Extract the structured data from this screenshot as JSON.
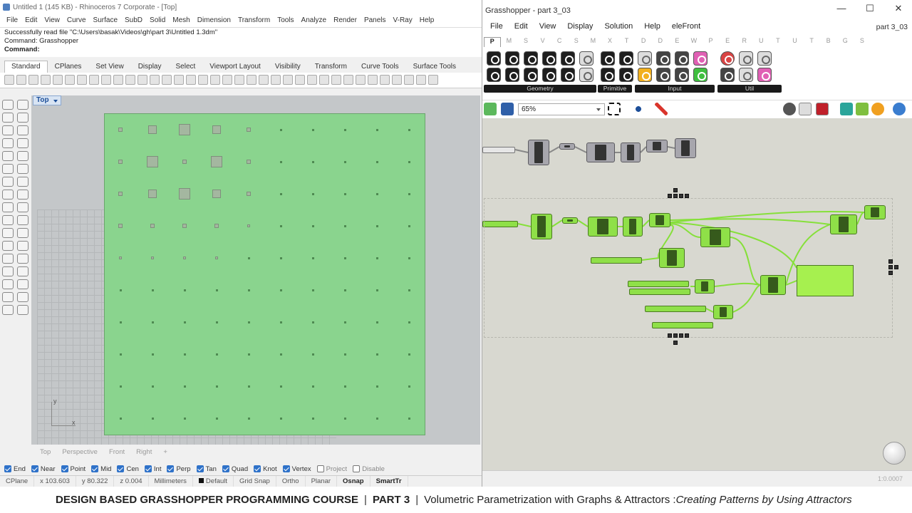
{
  "rhino": {
    "title": "Untitled 1 (145 KB) - Rhinoceros 7 Corporate - [Top]",
    "menu": [
      "File",
      "Edit",
      "View",
      "Curve",
      "Surface",
      "SubD",
      "Solid",
      "Mesh",
      "Dimension",
      "Transform",
      "Tools",
      "Analyze",
      "Render",
      "Panels",
      "V-Ray",
      "Help"
    ],
    "command_history": [
      "Successfully read file \"C:\\Users\\basak\\Videos\\gh\\part 3\\Untitled 1.3dm\"",
      "Command: Grasshopper"
    ],
    "command_prompt": "Command:",
    "toolbar_tabs": [
      "Standard",
      "CPlanes",
      "Set View",
      "Display",
      "Select",
      "Viewport Layout",
      "Visibility",
      "Transform",
      "Curve Tools",
      "Surface Tools"
    ],
    "active_tab": "Standard",
    "viewport_label": "Top",
    "axis_labels": {
      "x": "x",
      "y": "y"
    },
    "viewport_tabs": [
      "Top",
      "Perspective",
      "Front",
      "Right"
    ],
    "osnaps": [
      {
        "label": "End",
        "checked": true
      },
      {
        "label": "Near",
        "checked": true
      },
      {
        "label": "Point",
        "checked": true
      },
      {
        "label": "Mid",
        "checked": true
      },
      {
        "label": "Cen",
        "checked": true
      },
      {
        "label": "Int",
        "checked": true
      },
      {
        "label": "Perp",
        "checked": true
      },
      {
        "label": "Tan",
        "checked": true
      },
      {
        "label": "Quad",
        "checked": true
      },
      {
        "label": "Knot",
        "checked": true
      },
      {
        "label": "Vertex",
        "checked": true
      },
      {
        "label": "Project",
        "checked": false
      },
      {
        "label": "Disable",
        "checked": false
      }
    ],
    "status": {
      "cplane": "CPlane",
      "x": "x 103.603",
      "y": "y 80.322",
      "z": "z 0.004",
      "units": "Millimeters",
      "layer": "Default",
      "grid_snap": "Grid Snap",
      "ortho": "Ortho",
      "planar": "Planar",
      "osnap": "Osnap",
      "smarttrack": "SmartTr"
    },
    "colors": {
      "plane": "#8ad48e",
      "viewport_bg": "#c4c7c9"
    }
  },
  "grasshopper": {
    "title": "Grasshopper - part 3_03",
    "menu": [
      "File",
      "Edit",
      "View",
      "Display",
      "Solution",
      "Help",
      "eleFront"
    ],
    "doc_name": "part 3_03",
    "category_tabs": [
      "P",
      "M",
      "S",
      "V",
      "C",
      "S",
      "M",
      "X",
      "T",
      "D",
      "D",
      "E",
      "W",
      "P",
      "E",
      "R",
      "U",
      "T",
      "U",
      "T",
      "B",
      "G",
      "S"
    ],
    "active_category": "P",
    "ribbon_groups": [
      "Geometry",
      "Primitive",
      "Input",
      "Util"
    ],
    "zoom": "65%",
    "bottom_zoom": "1:0.0007",
    "colors": {
      "canvas": "#d8d8d0",
      "component": "#8fe048",
      "component_dark": "#365a1c",
      "wire": "#86e03a"
    }
  },
  "caption": {
    "course": "DESIGN BASED GRASSHOPPER PROGRAMMING COURSE",
    "separator": "|",
    "part": "PART 3",
    "topic": "Volumetric Parametrization with Graphs & Attractors :",
    "subtitle": "Creating Patterns by Using Attractors"
  }
}
